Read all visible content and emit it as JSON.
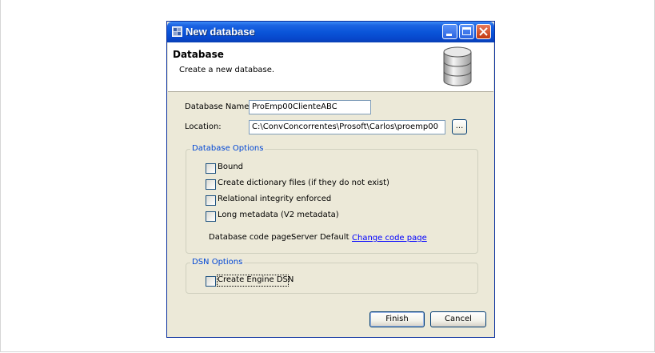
{
  "window": {
    "title": "New database"
  },
  "banner": {
    "title": "Database",
    "description": "Create a new database.",
    "icon": "database-icon"
  },
  "form": {
    "db_name_label": "Database Name:",
    "db_name_value": "ProEmp00ClienteABC",
    "location_label": "Location:",
    "location_value": "C:\\ConvConcorrentes\\Prosoft\\Carlos\\proemp00",
    "browse_label": "..."
  },
  "database_options": {
    "legend": "Database Options",
    "checkboxes": [
      {
        "label": "Bound",
        "checked": false
      },
      {
        "label": "Create dictionary files (if they do not exist)",
        "checked": false
      },
      {
        "label": "Relational integrity enforced",
        "checked": false
      },
      {
        "label": "Long metadata (V2 metadata)",
        "checked": false
      }
    ],
    "code_page_label": "Database code page:",
    "code_page_value": "Server Default",
    "change_code_page_link": "Change code page"
  },
  "dsn_options": {
    "legend": "DSN Options",
    "create_dsn_label": "Create Engine DSN",
    "checked": false
  },
  "buttons": {
    "finish": "Finish",
    "cancel": "Cancel"
  },
  "colors": {
    "title_bar": "#0a55d9",
    "dialog_bg": "#ece9d8",
    "legend_text": "#0046d5",
    "link": "#0000ff"
  }
}
